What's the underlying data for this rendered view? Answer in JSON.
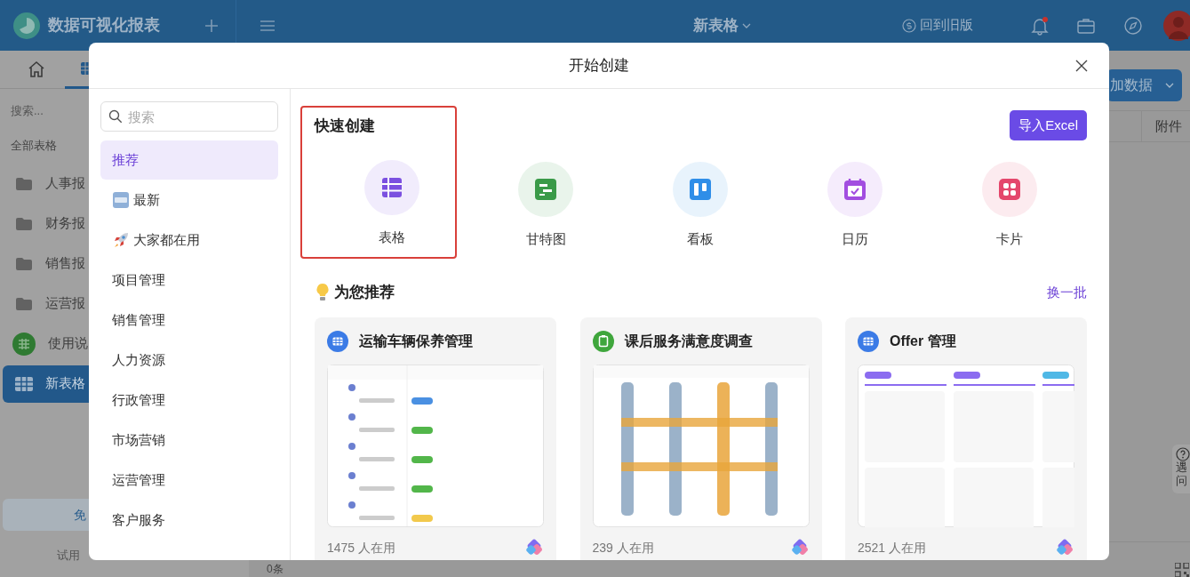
{
  "app_bar": {
    "title": "数据可视化报表",
    "doc_title": "新表格",
    "old_version": "回到旧版",
    "notification_dot": true
  },
  "sidebar": {
    "search": {
      "placeholder": "搜索..."
    },
    "section": "全部表格",
    "items": [
      {
        "label": "人事报",
        "kind": "folder",
        "selected": false
      },
      {
        "label": "财务报",
        "kind": "folder",
        "selected": false
      },
      {
        "label": "销售报",
        "kind": "folder",
        "selected": false
      },
      {
        "label": "运营报",
        "kind": "folder",
        "selected": false
      },
      {
        "label": "使用说",
        "kind": "guide",
        "selected": false
      },
      {
        "label": "新表格",
        "kind": "sheet",
        "selected": true
      }
    ],
    "trial_button": "免",
    "trial_note": "试用"
  },
  "toolbar": {
    "add_button": "加数据"
  },
  "table": {
    "columns": [
      {
        "label": "附件"
      }
    ]
  },
  "footer": {
    "count": "0条"
  },
  "help": {
    "lines": [
      "遇",
      "问"
    ]
  },
  "modal": {
    "title": "开始创建",
    "search": {
      "placeholder": "搜索"
    },
    "menu": [
      {
        "label": "推荐",
        "kind": "plain",
        "selected": true
      },
      {
        "label": "最新",
        "kind": "new-badge",
        "selected": false
      },
      {
        "label": "大家都在用",
        "kind": "rocket",
        "selected": false
      },
      {
        "label": "项目管理",
        "kind": "plain",
        "selected": false
      },
      {
        "label": "销售管理",
        "kind": "plain",
        "selected": false
      },
      {
        "label": "人力资源",
        "kind": "plain",
        "selected": false
      },
      {
        "label": "行政管理",
        "kind": "plain",
        "selected": false
      },
      {
        "label": "市场营销",
        "kind": "plain",
        "selected": false
      },
      {
        "label": "运营管理",
        "kind": "plain",
        "selected": false
      },
      {
        "label": "客户服务",
        "kind": "plain",
        "selected": false
      }
    ],
    "quick_create": {
      "title": "快速创建",
      "import_button": "导入Excel",
      "items": [
        {
          "label": "表格",
          "kind": "table",
          "color": "#7b50e0"
        },
        {
          "label": "甘特图",
          "kind": "gantt",
          "color": "#3a9a48"
        },
        {
          "label": "看板",
          "kind": "kanban",
          "color": "#2f8ee8"
        },
        {
          "label": "日历",
          "kind": "calendar",
          "color": "#a24ee0"
        },
        {
          "label": "卡片",
          "kind": "card",
          "color": "#e4476c"
        }
      ]
    },
    "recommend": {
      "title": "为您推荐",
      "refresh": "换一批",
      "cards": [
        {
          "title": "运输车辆保养管理",
          "kind": "grid",
          "color": "#3b7be6",
          "users": "1475 人在用"
        },
        {
          "title": "课后服务满意度调查",
          "kind": "clipboard",
          "color": "#3fa63c",
          "users": "239 人在用"
        },
        {
          "title": "Offer 管理",
          "kind": "grid",
          "color": "#3b7be6",
          "users": "2521 人在用"
        }
      ]
    }
  }
}
